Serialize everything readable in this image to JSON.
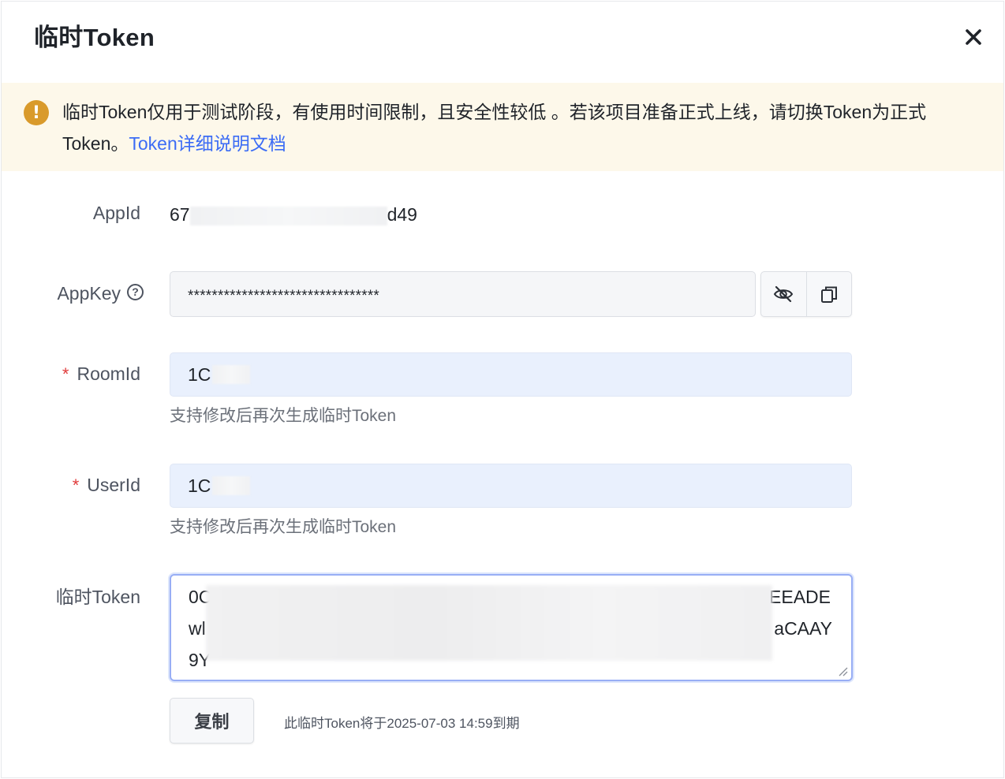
{
  "dialog": {
    "title": "临时Token",
    "close_icon": "close-icon"
  },
  "alert": {
    "icon": "warning-icon",
    "text": "临时Token仅用于测试阶段，有使用时间限制，且安全性较低 。若该项目准备正式上线，请切换Token为正式Token。",
    "link_label": "Token详细说明文档"
  },
  "form": {
    "appid": {
      "label": "AppId",
      "value_prefix": "67",
      "value_suffix": "d49"
    },
    "appkey": {
      "label": "AppKey",
      "help_icon": "question-circle-icon",
      "value": "********************************",
      "toggle_icon": "eye-off-icon",
      "copy_icon": "copy-icon"
    },
    "roomid": {
      "label": "RoomId",
      "required_mark": "*",
      "value": "1C",
      "hint": "支持修改后再次生成临时Token"
    },
    "userid": {
      "label": "UserId",
      "required_mark": "*",
      "value": "1C",
      "hint": "支持修改后再次生成临时Token"
    },
    "token": {
      "label": "临时Token",
      "line1_start": "0C",
      "line1_end": "EEADE",
      "line2_start": "wl",
      "line2_end": "aCAAY",
      "line3_start": "9Y"
    }
  },
  "footer": {
    "copy_label": "复制",
    "expire_text": "此临时Token将于2025-07-03 14:59到期"
  },
  "colors": {
    "link": "#3c6cf5",
    "alert_bg": "#fdf8ea",
    "warning": "#d99a2b",
    "required": "#e03c3c",
    "input_filled_bg": "#e9f0fd"
  }
}
